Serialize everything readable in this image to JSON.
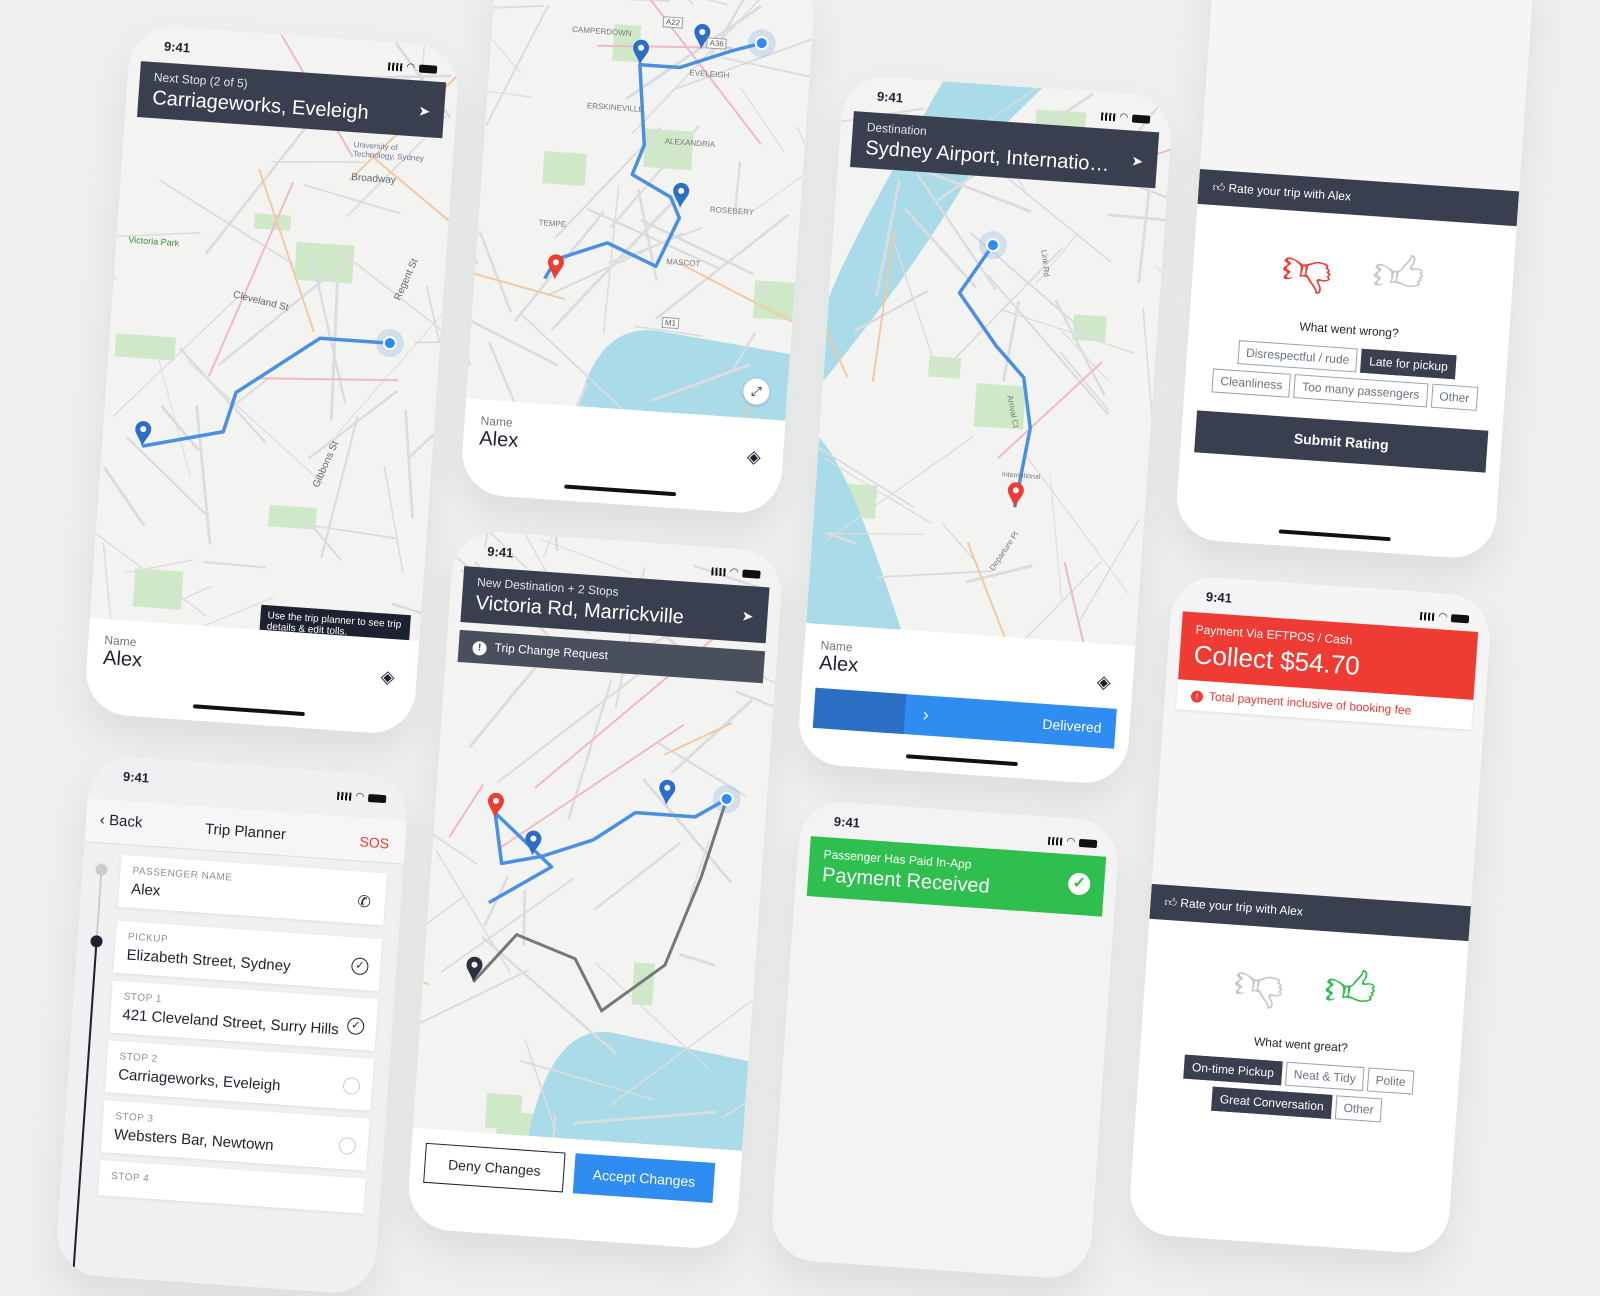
{
  "status_time": "9:41",
  "screen1": {
    "banner_small": "Next Stop (2 of 5)",
    "banner_big": "Carriageworks, Eveleigh",
    "map_labels": [
      "Broadway",
      "Cleveland St",
      "Regent St",
      "Gibbons St",
      "Victoria Park",
      "University of Technology, Sydney"
    ],
    "tooltip": "Use the trip planner to see trip details & edit tolls.",
    "name_label": "Name",
    "name_value": "Alex"
  },
  "screen2": {
    "map_labels": [
      "CAMPERDOWN",
      "EVELEIGH",
      "ERSKINEVILLE",
      "ALEXANDRIA",
      "ROSEBERY",
      "MASCOT",
      "TEMPE",
      "M1",
      "A22",
      "A36"
    ],
    "name_label": "Name",
    "name_value": "Alex"
  },
  "screen3": {
    "back": "Back",
    "title": "Trip Planner",
    "sos": "SOS",
    "items": [
      {
        "key": "PASSENGER NAME",
        "value": "Alex",
        "icon": "phone-icon"
      },
      {
        "key": "PICKUP",
        "value": "Elizabeth Street, Sydney",
        "done": true
      },
      {
        "key": "STOP 1",
        "value": "421 Cleveland Street, Surry Hills",
        "done": true
      },
      {
        "key": "STOP 2",
        "value": "Carriageworks, Eveleigh",
        "done": false
      },
      {
        "key": "STOP 3",
        "value": "Websters Bar, Newtown",
        "done": false
      },
      {
        "key": "STOP 4",
        "value": "",
        "done": false
      }
    ]
  },
  "screen4": {
    "banner_small": "New Destination + 2 Stops",
    "banner_big": "Victoria Rd, Marrickville",
    "alert": "Trip Change Request",
    "deny": "Deny Changes",
    "accept": "Accept Changes"
  },
  "screen5": {
    "banner_small": "Destination",
    "banner_big": "Sydney Airport, International Terminal",
    "map_labels": [
      "Link Rd",
      "Arrival Ct",
      "Departure Pl",
      "International"
    ],
    "name_label": "Name",
    "name_value": "Alex",
    "slider_label": "Delivered",
    "slider_progress": 0.3
  },
  "screen6": {
    "small": "Passenger Has Paid In-App",
    "big": "Payment Received",
    "color": "#2fbf4f"
  },
  "screen7": {
    "rate_title": "Rate your trip with Alex",
    "question": "What went wrong?",
    "options": [
      "Disrespectful / rude",
      "Late for pickup",
      "Cleanliness",
      "Too many passengers",
      "Other"
    ],
    "selected": [
      "Late for pickup"
    ],
    "submit": "Submit Rating",
    "rating": "thumbs-down"
  },
  "screen8": {
    "small": "Payment Via EFTPOS / Cash",
    "big": "Collect $54.70",
    "note": "Total payment inclusive of booking fee",
    "color": "#ee3b33",
    "rate_title": "Rate your trip with Alex",
    "question": "What went great?",
    "options": [
      "On-time Pickup",
      "Neat & Tidy",
      "Polite",
      "Great Conversation",
      "Other"
    ],
    "selected": [
      "On-time Pickup",
      "Great Conversation"
    ],
    "rating": "thumbs-up"
  },
  "colors": {
    "dark": "#3a3f4f",
    "route": "#4a90e2",
    "accent_blue": "#2f8cf0",
    "red": "#ee3b33",
    "green": "#2fbf4f"
  }
}
